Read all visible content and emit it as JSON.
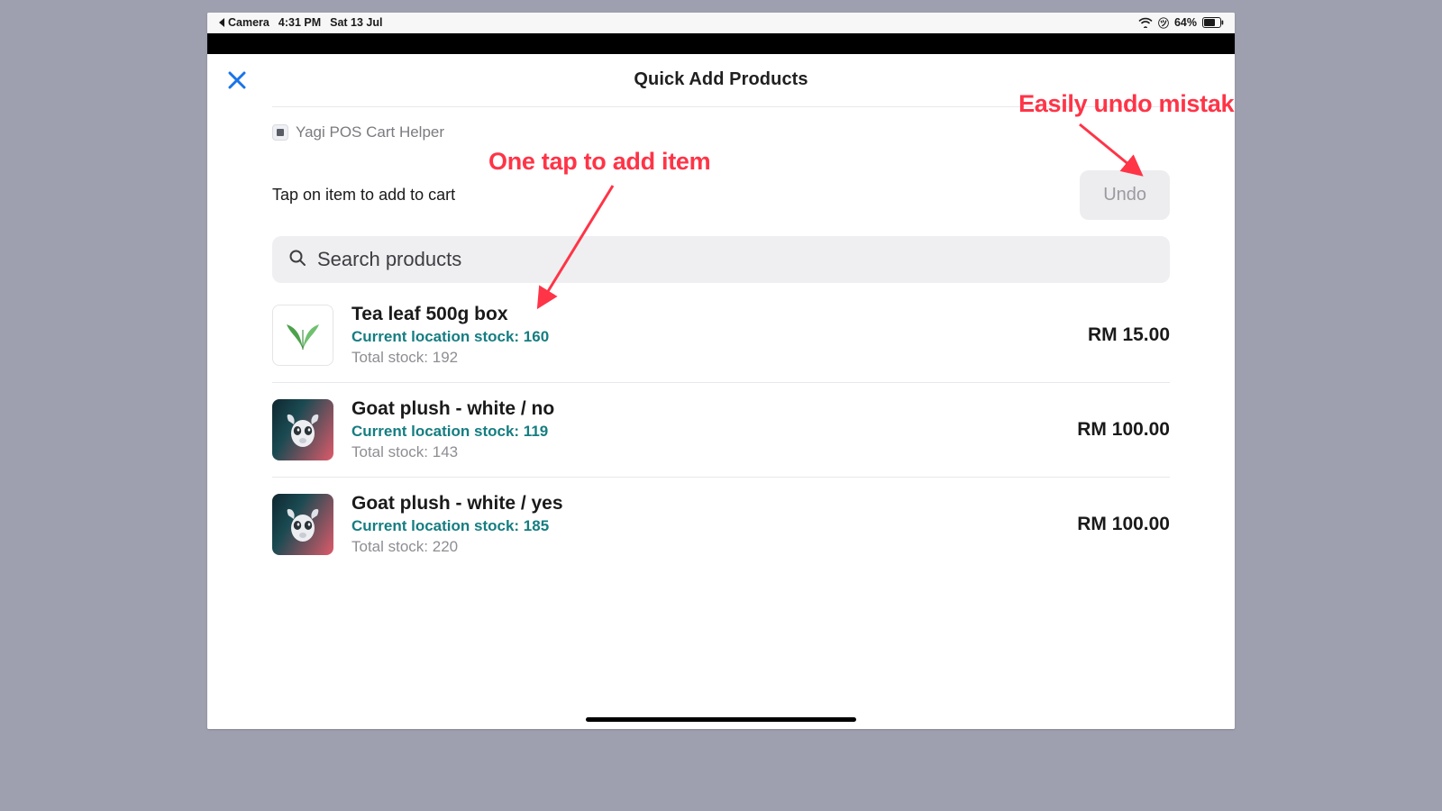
{
  "status_bar": {
    "back_app": "Camera",
    "time": "4:31 PM",
    "date": "Sat 13 Jul",
    "battery_pct": "64%"
  },
  "modal": {
    "title": "Quick Add Products",
    "app_tag": "Yagi POS Cart Helper",
    "hint": "Tap on item to add to cart",
    "undo_label": "Undo",
    "search_placeholder": "Search products"
  },
  "annotations": {
    "tap": "One tap to add item",
    "undo": "Easily undo mistake"
  },
  "products": [
    {
      "name": "Tea leaf 500g box",
      "loc_stock_label": "Current location stock: 160",
      "total_stock_label": "Total stock: 192",
      "price": "RM 15.00",
      "thumb": "leaf"
    },
    {
      "name": "Goat plush - white / no",
      "loc_stock_label": "Current location stock: 119",
      "total_stock_label": "Total stock: 143",
      "price": "RM 100.00",
      "thumb": "goat"
    },
    {
      "name": "Goat plush - white / yes",
      "loc_stock_label": "Current location stock: 185",
      "total_stock_label": "Total stock: 220",
      "price": "RM 100.00",
      "thumb": "goat"
    }
  ]
}
